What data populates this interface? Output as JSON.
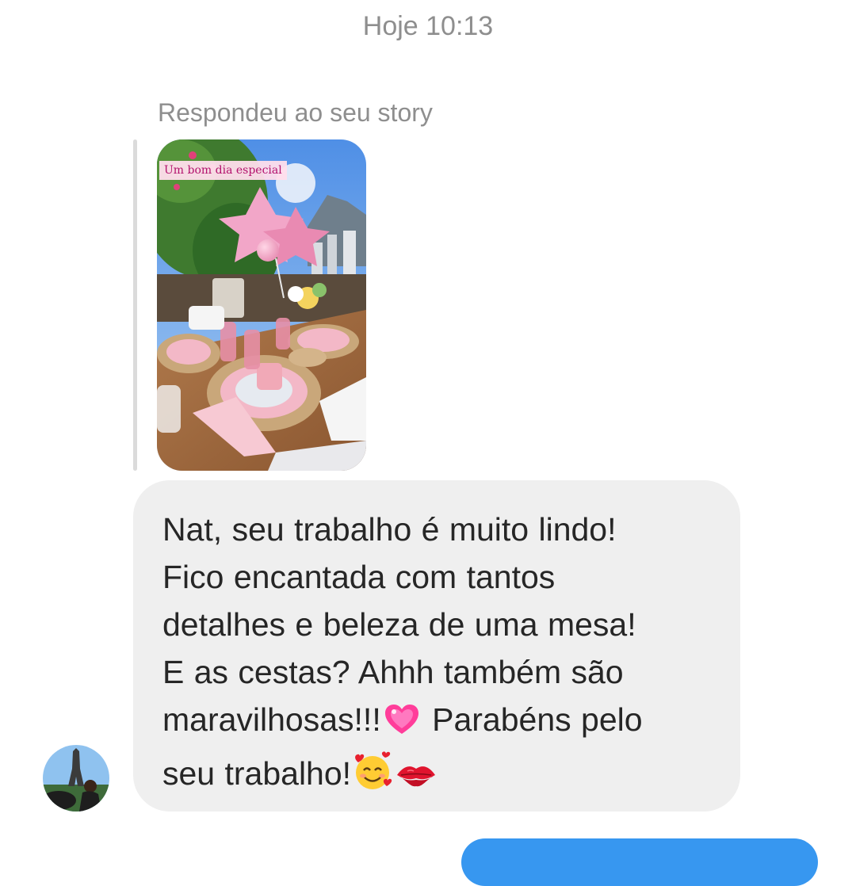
{
  "thread": {
    "timestamp": "Hoje 10:13"
  },
  "story_reply": {
    "label": "Respondeu ao seu story",
    "story_caption": "Um bom dia especial"
  },
  "message": {
    "line1": "Nat, seu trabalho é muito lindo!",
    "line2": "Fico encantada com tantos",
    "line3": "detalhes e beleza de uma mesa!",
    "line4": "E as cestas? Ahhh também são",
    "line5a": "maravilhosas!!!",
    "line5b": " Parabéns pelo",
    "line6": "seu trabalho!",
    "emojis": [
      "sparkling-heart-icon",
      "smiling-face-with-hearts-icon",
      "kiss-mark-icon"
    ]
  },
  "colors": {
    "background": "#ffffff",
    "received_bubble": "#efefef",
    "sent_bubble": "#3797f0",
    "meta_text": "#8e8e8e",
    "message_text": "#262626"
  }
}
